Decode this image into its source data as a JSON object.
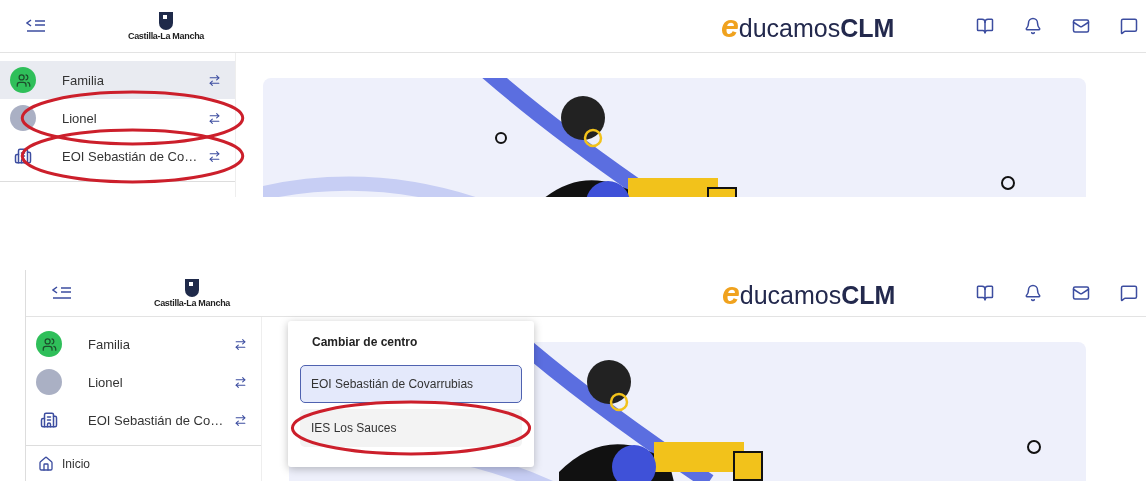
{
  "panels": [
    {
      "header": {
        "logo_caption": "Castilla-La Mancha",
        "brand_mark": "e",
        "brand_name": "ducamos",
        "brand_suffix": "CLM"
      },
      "sidebar": {
        "items": [
          {
            "kind": "group",
            "label": "Familia",
            "selected": true,
            "circled": false
          },
          {
            "kind": "person",
            "label": "Lionel",
            "selected": false,
            "circled": true
          },
          {
            "kind": "building",
            "label": "EOI Sebastián de Co…",
            "selected": false,
            "circled": true
          }
        ]
      }
    },
    {
      "header": {
        "logo_caption": "Castilla-La Mancha",
        "brand_mark": "e",
        "brand_name": "ducamos",
        "brand_suffix": "CLM"
      },
      "sidebar": {
        "items": [
          {
            "kind": "group",
            "label": "Familia",
            "selected": false,
            "circled": false
          },
          {
            "kind": "person",
            "label": "Lionel",
            "selected": false,
            "circled": false
          },
          {
            "kind": "building",
            "label": "EOI Sebastián de Co…",
            "selected": false,
            "circled": false
          }
        ],
        "nav": [
          {
            "label": "Inicio"
          }
        ]
      },
      "menu": {
        "title": "Cambiar de centro",
        "options": [
          {
            "label": "EOI Sebastián de Covarrubias",
            "selected": true,
            "circled": false
          },
          {
            "label": "IES Los Sauces",
            "selected": false,
            "circled": true
          }
        ]
      }
    }
  ]
}
